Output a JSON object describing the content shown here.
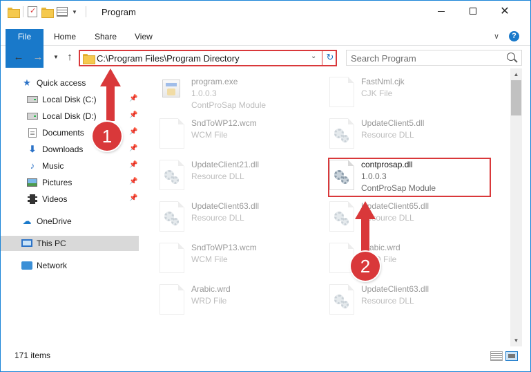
{
  "window": {
    "title": "Program"
  },
  "ribbon": {
    "tabs": [
      {
        "label": "File"
      },
      {
        "label": "Home"
      },
      {
        "label": "Share"
      },
      {
        "label": "View"
      }
    ],
    "help_label": "?"
  },
  "address": {
    "path": "C:\\Program Files\\Program Directory"
  },
  "search": {
    "placeholder": "Search Program"
  },
  "sidebar": {
    "items": [
      {
        "label": "Quick access",
        "icon": "star-icon"
      },
      {
        "label": "Local Disk (C:)",
        "icon": "drive-icon",
        "pinned": true
      },
      {
        "label": "Local Disk (D:)",
        "icon": "drive-icon",
        "pinned": true
      },
      {
        "label": "Documents",
        "icon": "documents-icon",
        "pinned": true
      },
      {
        "label": "Downloads",
        "icon": "download-icon",
        "pinned": true
      },
      {
        "label": "Music",
        "icon": "music-icon",
        "pinned": true
      },
      {
        "label": "Pictures",
        "icon": "pictures-icon",
        "pinned": true
      },
      {
        "label": "Videos",
        "icon": "videos-icon",
        "pinned": true
      },
      {
        "label": "OneDrive",
        "icon": "cloud-icon"
      },
      {
        "label": "This PC",
        "icon": "computer-icon",
        "selected": true
      },
      {
        "label": "Network",
        "icon": "network-icon"
      }
    ]
  },
  "files": [
    {
      "name": "program.exe",
      "line2": "1.0.0.3",
      "line3": "ContProSap Module",
      "icon": "exe-icon"
    },
    {
      "name": "FastNml.cjk",
      "line2": "CJK File",
      "line3": "",
      "icon": "blank-file-icon"
    },
    {
      "name": "SndToWP12.wcm",
      "line2": "WCM File",
      "line3": "",
      "icon": "blank-file-icon"
    },
    {
      "name": "UpdateClient5.dll",
      "line2": "Resource DLL",
      "line3": "",
      "icon": "dll-icon"
    },
    {
      "name": "UpdateClient21.dll",
      "line2": "Resource DLL",
      "line3": "",
      "icon": "dll-icon"
    },
    {
      "name": "contprosap.dll",
      "line2": "1.0.0.3",
      "line3": "ContProSap Module",
      "icon": "dll-icon"
    },
    {
      "name": "UpdateClient63.dll",
      "line2": "Resource DLL",
      "line3": "",
      "icon": "dll-icon"
    },
    {
      "name": "UpdateClient65.dll",
      "line2": "Resource DLL",
      "line3": "",
      "icon": "dll-icon"
    },
    {
      "name": "SndToWP13.wcm",
      "line2": "WCM File",
      "line3": "",
      "icon": "blank-file-icon"
    },
    {
      "name": "Arabic.wrd",
      "line2": "WRD File",
      "line3": "",
      "icon": "blank-file-icon"
    },
    {
      "name": "Arabic.wrd",
      "line2": "WRD File",
      "line3": "",
      "icon": "blank-file-icon"
    },
    {
      "name": "UpdateClient63.dll",
      "line2": "Resource DLL",
      "line3": "",
      "icon": "dll-icon"
    }
  ],
  "status": {
    "item_count": "171 items"
  },
  "annotations": {
    "step1": "1",
    "step2": "2"
  },
  "colors": {
    "accent": "#1979ca",
    "highlight_red": "#d9383a",
    "selected_nav": "#d9d9d9"
  }
}
